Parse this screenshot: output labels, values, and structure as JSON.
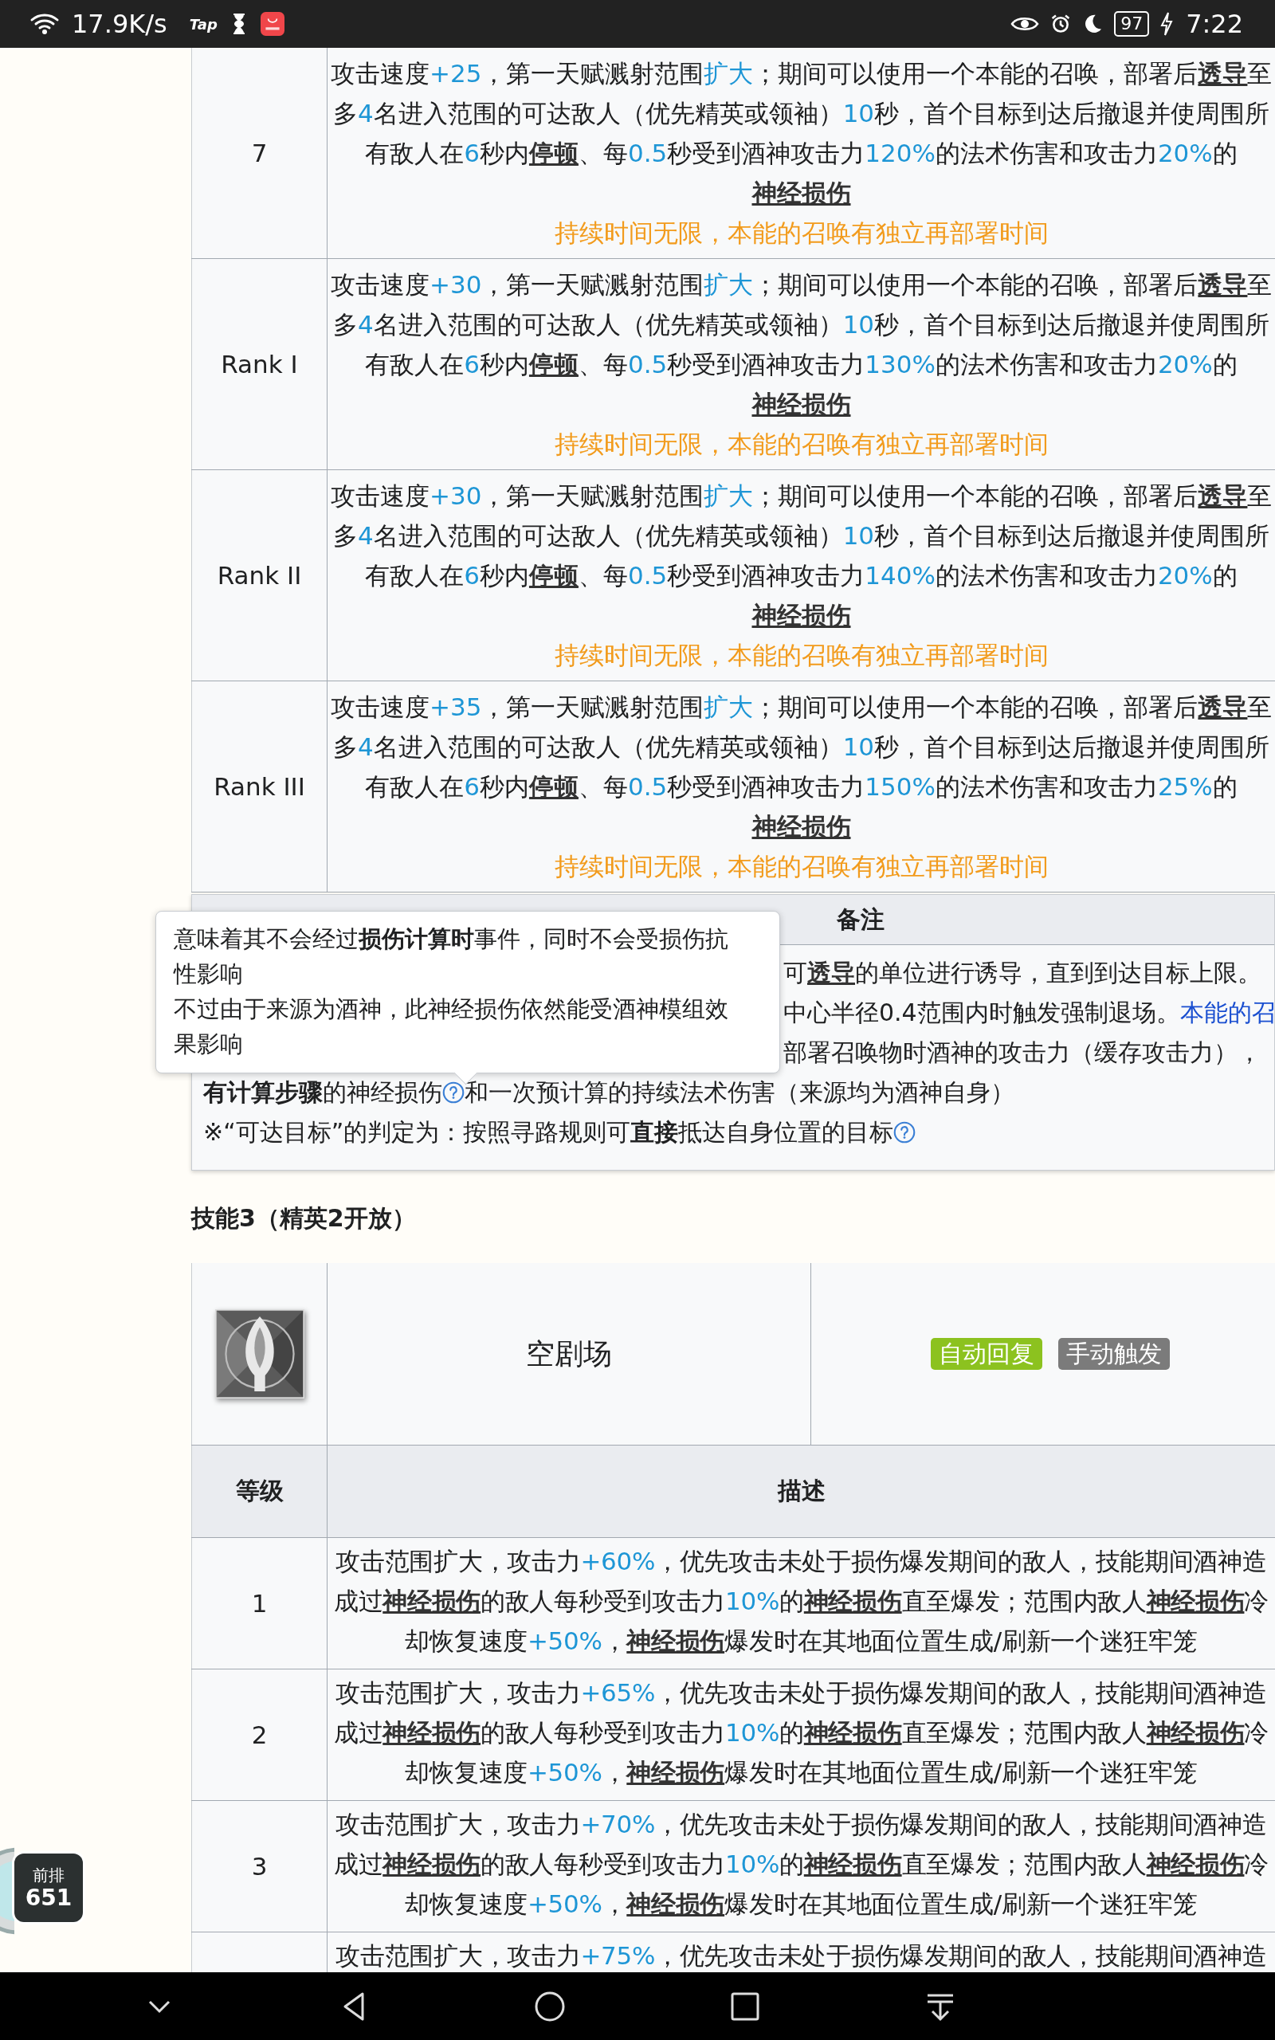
{
  "status_bar": {
    "net_speed": "17.9K/s",
    "app_label": "Tap",
    "battery": "97",
    "time": "7:22"
  },
  "skill2_table": {
    "rows": [
      {
        "level": "7",
        "lines": [
          [
            "攻击速度",
            {
              "kind": "value",
              "text": "+25"
            },
            "，第一天赋溅射范围",
            {
              "kind": "value",
              "text": "扩大"
            },
            "；期间可以使用一个本能的召唤，部署后",
            {
              "kind": "term",
              "text": "透导"
            },
            "至"
          ],
          [
            "多",
            {
              "kind": "value",
              "text": "4"
            },
            "名进入范围的可达敌人（优先精英或领袖）",
            {
              "kind": "value",
              "text": "10"
            },
            "秒，首个目标到达后撤退并使周围所"
          ],
          [
            "有敌人在",
            {
              "kind": "value",
              "text": "6"
            },
            "秒内",
            {
              "kind": "term",
              "text": "停顿"
            },
            "、每",
            {
              "kind": "value",
              "text": "0.5"
            },
            "秒受到酒神攻击力",
            {
              "kind": "value",
              "text": "120%"
            },
            "的法术伤害和攻击力",
            {
              "kind": "value",
              "text": "20%"
            },
            "的"
          ],
          [
            {
              "kind": "term",
              "text": "神经损伤"
            }
          ]
        ],
        "note": "持续时间无限，本能的召唤有独立再部署时间"
      },
      {
        "level": "Rank I",
        "lines": [
          [
            "攻击速度",
            {
              "kind": "value",
              "text": "+30"
            },
            "，第一天赋溅射范围",
            {
              "kind": "value",
              "text": "扩大"
            },
            "；期间可以使用一个本能的召唤，部署后",
            {
              "kind": "term",
              "text": "透导"
            },
            "至"
          ],
          [
            "多",
            {
              "kind": "value",
              "text": "4"
            },
            "名进入范围的可达敌人（优先精英或领袖）",
            {
              "kind": "value",
              "text": "10"
            },
            "秒，首个目标到达后撤退并使周围所"
          ],
          [
            "有敌人在",
            {
              "kind": "value",
              "text": "6"
            },
            "秒内",
            {
              "kind": "term",
              "text": "停顿"
            },
            "、每",
            {
              "kind": "value",
              "text": "0.5"
            },
            "秒受到酒神攻击力",
            {
              "kind": "value",
              "text": "130%"
            },
            "的法术伤害和攻击力",
            {
              "kind": "value",
              "text": "20%"
            },
            "的"
          ],
          [
            {
              "kind": "term",
              "text": "神经损伤"
            }
          ]
        ],
        "note": "持续时间无限，本能的召唤有独立再部署时间"
      },
      {
        "level": "Rank II",
        "lines": [
          [
            "攻击速度",
            {
              "kind": "value",
              "text": "+30"
            },
            "，第一天赋溅射范围",
            {
              "kind": "value",
              "text": "扩大"
            },
            "；期间可以使用一个本能的召唤，部署后",
            {
              "kind": "term",
              "text": "透导"
            },
            "至"
          ],
          [
            "多",
            {
              "kind": "value",
              "text": "4"
            },
            "名进入范围的可达敌人（优先精英或领袖）",
            {
              "kind": "value",
              "text": "10"
            },
            "秒，首个目标到达后撤退并使周围所"
          ],
          [
            "有敌人在",
            {
              "kind": "value",
              "text": "6"
            },
            "秒内",
            {
              "kind": "term",
              "text": "停顿"
            },
            "、每",
            {
              "kind": "value",
              "text": "0.5"
            },
            "秒受到酒神攻击力",
            {
              "kind": "value",
              "text": "140%"
            },
            "的法术伤害和攻击力",
            {
              "kind": "value",
              "text": "20%"
            },
            "的"
          ],
          [
            {
              "kind": "term",
              "text": "神经损伤"
            }
          ]
        ],
        "note": "持续时间无限，本能的召唤有独立再部署时间"
      },
      {
        "level": "Rank III",
        "lines": [
          [
            "攻击速度",
            {
              "kind": "value",
              "text": "+35"
            },
            "，第一天赋溅射范围",
            {
              "kind": "value",
              "text": "扩大"
            },
            "；期间可以使用一个本能的召唤，部署后",
            {
              "kind": "term",
              "text": "透导"
            },
            "至"
          ],
          [
            "多",
            {
              "kind": "value",
              "text": "4"
            },
            "名进入范围的可达敌人（优先精英或领袖）",
            {
              "kind": "value",
              "text": "10"
            },
            "秒，首个目标到达后撤退并使周围所"
          ],
          [
            "有敌人在",
            {
              "kind": "value",
              "text": "6"
            },
            "秒内",
            {
              "kind": "term",
              "text": "停顿"
            },
            "、每",
            {
              "kind": "value",
              "text": "0.5"
            },
            "秒受到酒神攻击力",
            {
              "kind": "value",
              "text": "150%"
            },
            "的法术伤害和攻击力",
            {
              "kind": "value",
              "text": "25%"
            },
            "的"
          ],
          [
            {
              "kind": "term",
              "text": "神经损伤"
            }
          ]
        ],
        "note": "持续时间无限，本能的召唤有独立再部署时间"
      }
    ]
  },
  "remarks": {
    "heading": "备注",
    "lines": [
      {
        "kind": "partial",
        "segments": [
          "可",
          {
            "kind": "term",
            "text": "透导"
          },
          "的单位进行诱导，直到到达目标上限。"
        ]
      },
      {
        "kind": "partial",
        "segments": [
          "中心半径0.4范围内时触发强制退场。",
          {
            "kind": "link",
            "text": "本能的召"
          }
        ]
      },
      {
        "kind": "partial",
        "segments": [
          "部署召唤物时酒神的攻击力（缓存攻击力），"
        ]
      },
      {
        "kind": "full",
        "segments": [
          {
            "kind": "bold",
            "text": "有计算步骤"
          },
          "的神经损伤",
          {
            "kind": "help"
          },
          "和一次预计算的持续法术伤害（来源均为酒神自身）"
        ]
      },
      {
        "kind": "full",
        "segments": [
          "※“可达目标”的判定为：按照寻路规则可",
          {
            "kind": "bold",
            "text": "直接"
          },
          "抵达自身位置的目标",
          {
            "kind": "help"
          }
        ]
      }
    ],
    "tooltip": {
      "paragraphs": [
        [
          "意味着其不会经过",
          {
            "kind": "bold",
            "text": "损伤计算时"
          },
          "事件，同时不会受损伤抗性影响"
        ],
        [
          "不过由于来源为酒神，此神经损伤依然能受酒神模组效果影响"
        ]
      ]
    }
  },
  "skill3": {
    "heading": "技能3（精英2开放）",
    "name": "空剧场",
    "tags": [
      {
        "label": "自动回复",
        "color": "#8cc21f"
      },
      {
        "label": "手动触发",
        "color": "#7b7b7b"
      }
    ],
    "columns": [
      "等级",
      "描述"
    ],
    "rows": [
      {
        "level": "1",
        "lines": [
          [
            "攻击范围扩大，攻击力",
            {
              "kind": "value",
              "text": "+60%"
            },
            "，优先攻击未处于损伤爆发期间的敌人，技能期间酒神造"
          ],
          [
            "成过",
            {
              "kind": "term",
              "text": "神经损伤"
            },
            "的敌人每秒受到攻击力",
            {
              "kind": "value",
              "text": "10%"
            },
            "的",
            {
              "kind": "term",
              "text": "神经损伤"
            },
            "直至爆发；范围内敌人",
            {
              "kind": "term",
              "text": "神经损伤"
            },
            "冷"
          ],
          [
            "却恢复速度",
            {
              "kind": "value",
              "text": "+50%"
            },
            "，",
            {
              "kind": "term",
              "text": "神经损伤"
            },
            "爆发时在其地面位置生成/刷新一个迷狂牢笼"
          ]
        ]
      },
      {
        "level": "2",
        "lines": [
          [
            "攻击范围扩大，攻击力",
            {
              "kind": "value",
              "text": "+65%"
            },
            "，优先攻击未处于损伤爆发期间的敌人，技能期间酒神造"
          ],
          [
            "成过",
            {
              "kind": "term",
              "text": "神经损伤"
            },
            "的敌人每秒受到攻击力",
            {
              "kind": "value",
              "text": "10%"
            },
            "的",
            {
              "kind": "term",
              "text": "神经损伤"
            },
            "直至爆发；范围内敌人",
            {
              "kind": "term",
              "text": "神经损伤"
            },
            "冷"
          ],
          [
            "却恢复速度",
            {
              "kind": "value",
              "text": "+50%"
            },
            "，",
            {
              "kind": "term",
              "text": "神经损伤"
            },
            "爆发时在其地面位置生成/刷新一个迷狂牢笼"
          ]
        ]
      },
      {
        "level": "3",
        "lines": [
          [
            "攻击范围扩大，攻击力",
            {
              "kind": "value",
              "text": "+70%"
            },
            "，优先攻击未处于损伤爆发期间的敌人，技能期间酒神造"
          ],
          [
            "成过",
            {
              "kind": "term",
              "text": "神经损伤"
            },
            "的敌人每秒受到攻击力",
            {
              "kind": "value",
              "text": "10%"
            },
            "的",
            {
              "kind": "term",
              "text": "神经损伤"
            },
            "直至爆发；范围内敌人",
            {
              "kind": "term",
              "text": "神经损伤"
            },
            "冷"
          ],
          [
            "却恢复速度",
            {
              "kind": "value",
              "text": "+50%"
            },
            "，",
            {
              "kind": "term",
              "text": "神经损伤"
            },
            "爆发时在其地面位置生成/刷新一个迷狂牢笼"
          ]
        ]
      },
      {
        "lines": [
          [
            "攻击范围扩大，攻击力",
            {
              "kind": "value",
              "text": "+75%"
            },
            "，优先攻击未处于损伤爆发期间的敌人，技能期间酒神造"
          ]
        ]
      }
    ]
  },
  "floating_badge": {
    "label": "前排",
    "count": "651"
  }
}
